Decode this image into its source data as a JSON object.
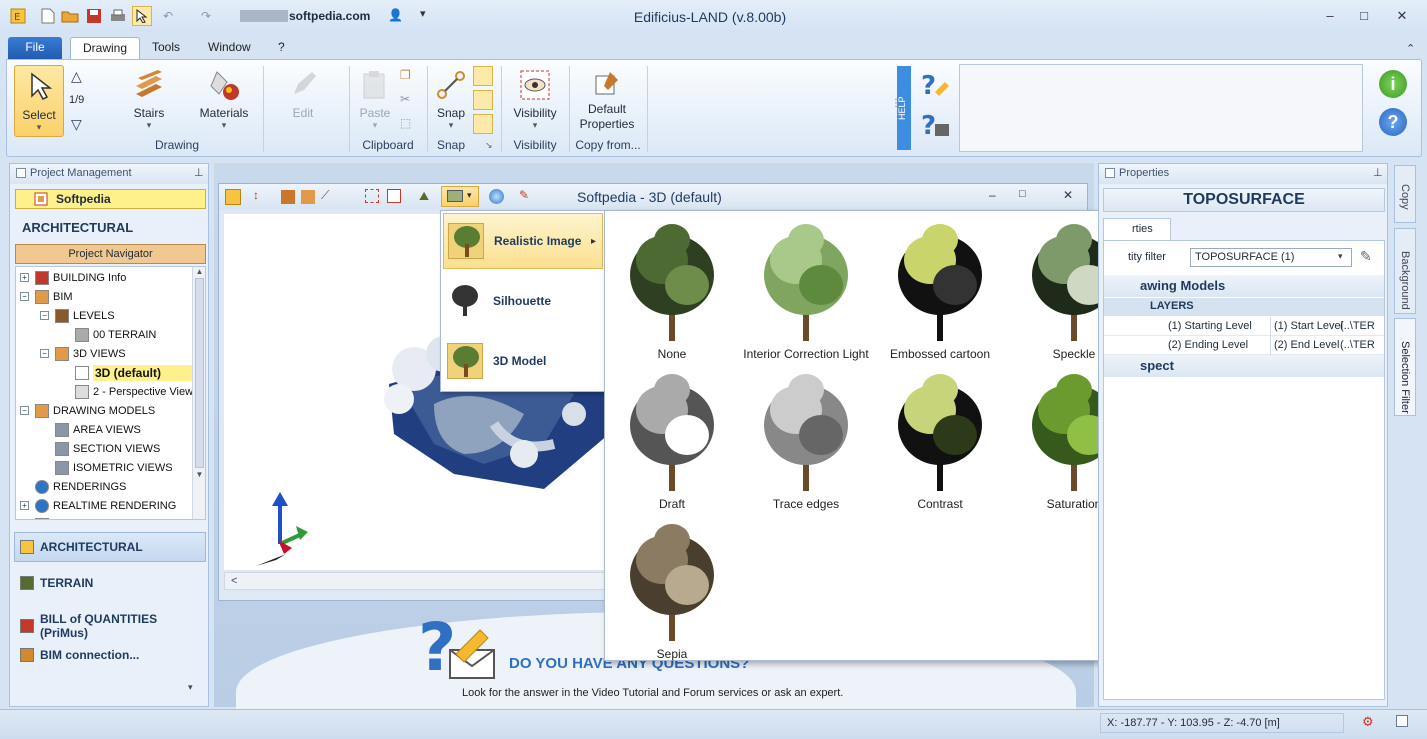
{
  "window": {
    "title": "Edificius-LAND (v.8.00b)",
    "account": "softpedia.com",
    "minimize": "‒",
    "maximize": "□",
    "close": "✕"
  },
  "menu_tabs": [
    "File",
    "Drawing",
    "Tools",
    "Window",
    "?"
  ],
  "ribbon": {
    "select_label": "Select",
    "level_counter": "1/9",
    "stairs_label": "Stairs",
    "materials_label": "Materials",
    "edit_label": "Edit",
    "paste_label": "Paste",
    "snap_label": "Snap",
    "visibility_label": "Visibility",
    "default_props_label": "Default Properties",
    "groups": {
      "drawing": "Drawing",
      "clipboard": "Clipboard",
      "snap": "Snap",
      "visibility": "Visibility",
      "copy_from": "Copy from..."
    },
    "help_tab": "HELP"
  },
  "project": {
    "header": "Project Management",
    "project_name": "Softpedia",
    "section": "ARCHITECTURAL",
    "navigator": "Project Navigator",
    "tree": [
      {
        "label": "BUILDING Info",
        "indent": 0,
        "pm": "+"
      },
      {
        "label": "BIM",
        "indent": 0,
        "pm": "−"
      },
      {
        "label": "LEVELS",
        "indent": 1,
        "pm": "−"
      },
      {
        "label": "00 TERRAIN",
        "indent": 2,
        "pm": ""
      },
      {
        "label": "3D VIEWS",
        "indent": 1,
        "pm": "−"
      },
      {
        "label": "3D (default)",
        "indent": 2,
        "pm": "",
        "selected": true
      },
      {
        "label": "2 - Perspective View",
        "indent": 2,
        "pm": ""
      },
      {
        "label": "DRAWING MODELS",
        "indent": 0,
        "pm": "−"
      },
      {
        "label": "AREA VIEWS",
        "indent": 1,
        "pm": ""
      },
      {
        "label": "SECTION VIEWS",
        "indent": 1,
        "pm": ""
      },
      {
        "label": "ISOMETRIC VIEWS",
        "indent": 1,
        "pm": ""
      },
      {
        "label": "RENDERINGS",
        "indent": 0,
        "pm": ""
      },
      {
        "label": "REALTIME RENDERING",
        "indent": 0,
        "pm": "+"
      },
      {
        "label": "CATALOGUE",
        "indent": 0,
        "pm": "+"
      }
    ],
    "modules": [
      "ARCHITECTURAL",
      "TERRAIN",
      "BILL of QUANTITIES (PriMus)",
      "BIM connection..."
    ]
  },
  "view3d": {
    "title": "Softpedia - 3D (default)"
  },
  "render_menu": {
    "items": [
      "Realistic Image",
      "Silhouette",
      "3D Model"
    ]
  },
  "styles": [
    "None",
    "Interior Correction Light",
    "Embossed cartoon",
    "Speckle",
    "Draft",
    "Trace edges",
    "Contrast",
    "Saturation",
    "Sepia"
  ],
  "properties": {
    "header": "Properties",
    "title": "TOPOSURFACE",
    "tab": "rties",
    "filter_label": "tity filter",
    "filter_value": "TOPOSURFACE (1)",
    "section1": "awing Models",
    "layers": "LAYERS",
    "rows": [
      {
        "name": "(1) Starting Level",
        "value": "(1) Start Level",
        "extra": "(..\\TER"
      },
      {
        "name": "(2) Ending Level",
        "value": "(2) End Level",
        "extra": "(..\\TER"
      }
    ],
    "section2": "spect"
  },
  "side_tabs": [
    "Copy",
    "Background",
    "Selection Filter"
  ],
  "help_banner": {
    "question": "DO YOU HAVE ANY QUESTIONS?",
    "text": "Look for the answer in the Video Tutorial and Forum services or ask an expert."
  },
  "status": {
    "coords": "X: -187.77 - Y: 103.95 - Z: -4.70 [m]"
  },
  "colors": {
    "accent": "#1f5bb0",
    "selected": "#fef08a",
    "panel_bg": "#e9f0f9",
    "dark_blue": "#1e3a5f"
  }
}
